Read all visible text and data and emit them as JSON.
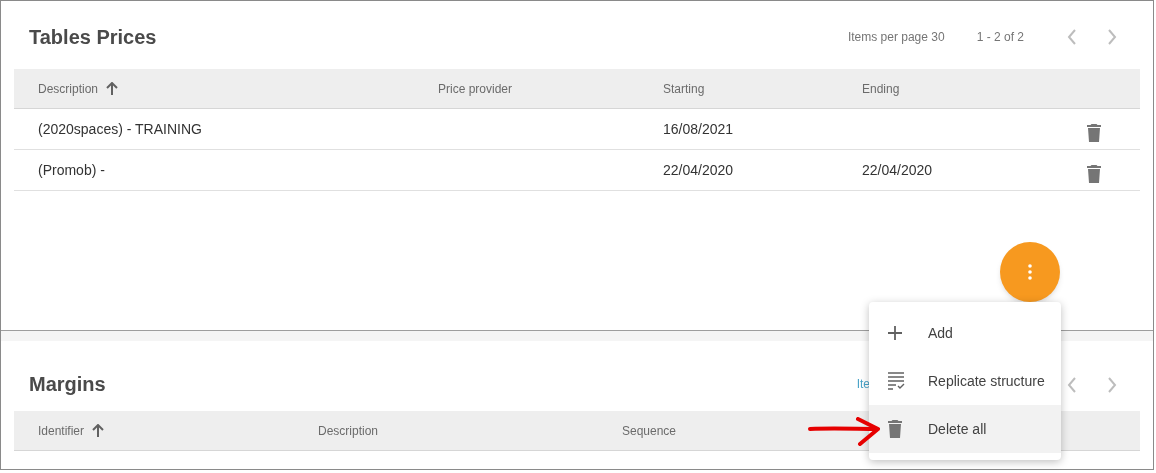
{
  "tables_prices": {
    "title": "Tables Prices",
    "pager": {
      "items_per_page": "Items per page 30",
      "range": "1 - 2 of 2"
    },
    "columns": [
      {
        "label": "Description",
        "sorted": true
      },
      {
        "label": "Price provider",
        "sorted": false
      },
      {
        "label": "Starting",
        "sorted": false
      },
      {
        "label": "Ending",
        "sorted": false
      }
    ],
    "rows": [
      {
        "cells": [
          "(2020spaces) - TRAINING",
          "",
          "16/08/2021",
          ""
        ]
      },
      {
        "cells": [
          "(Promob) -",
          "",
          "22/04/2020",
          "22/04/2020"
        ]
      }
    ]
  },
  "margins": {
    "title": "Margins",
    "pager": {
      "items_per_page": "Ite"
    },
    "columns": [
      {
        "label": "Identifier",
        "sorted": true
      },
      {
        "label": "Description",
        "sorted": false
      },
      {
        "label": "Sequence",
        "sorted": false
      }
    ]
  },
  "menu": {
    "items": [
      {
        "kind": "add",
        "label": "Add",
        "selected": false
      },
      {
        "kind": "replicate",
        "label": "Replicate structure",
        "selected": false
      },
      {
        "kind": "delete",
        "label": "Delete all",
        "selected": true
      }
    ]
  }
}
